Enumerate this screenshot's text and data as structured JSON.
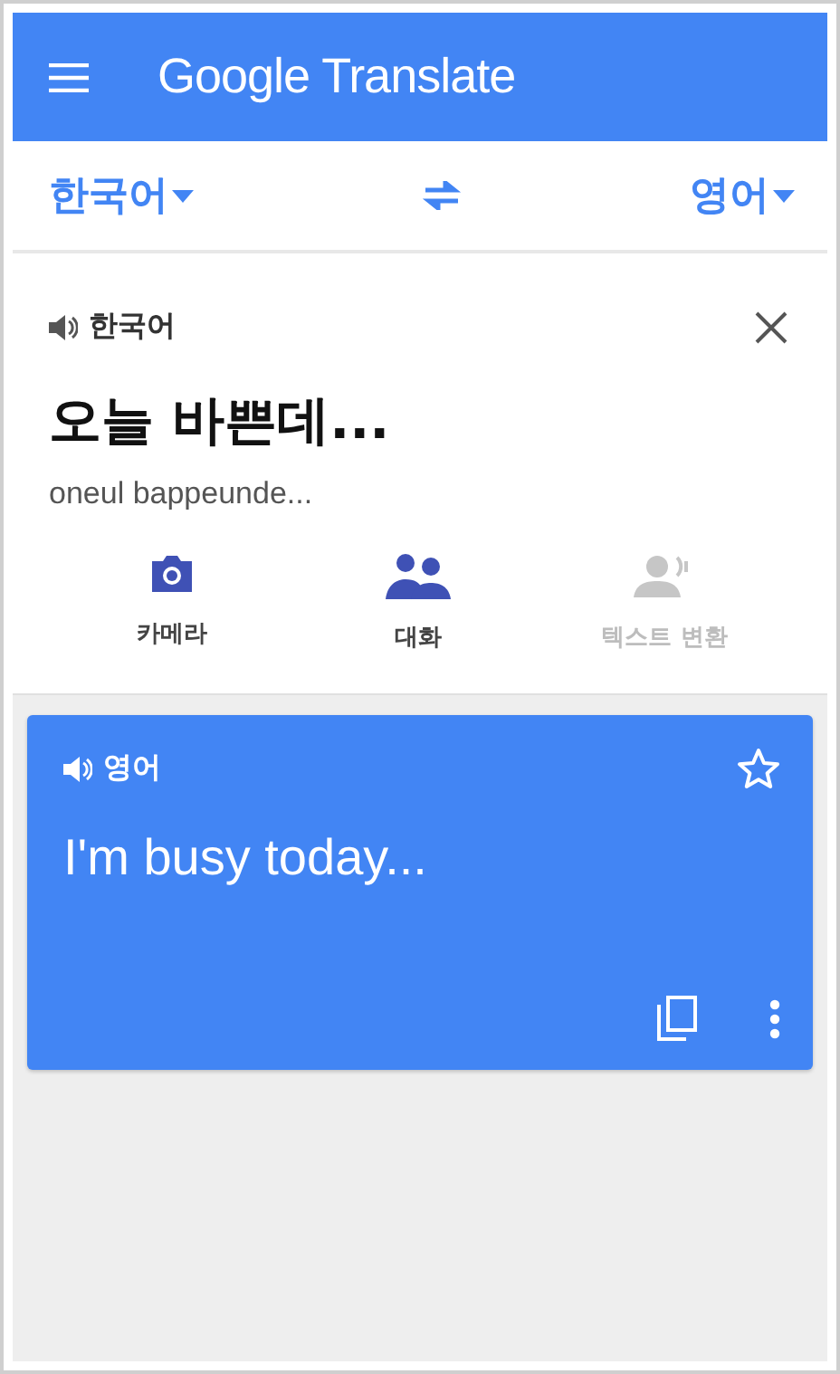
{
  "app_bar": {
    "title": "Google Translate"
  },
  "language_bar": {
    "source": "한국어",
    "target": "영어"
  },
  "input": {
    "language": "한국어",
    "text": "오늘 바쁜데...",
    "romanization": "oneul bappeunde..."
  },
  "tools": [
    {
      "kind": "camera",
      "label": "카메라",
      "disabled": false
    },
    {
      "kind": "conversation",
      "label": "대화",
      "disabled": false
    },
    {
      "kind": "transcribe",
      "label": "텍스트 변환",
      "disabled": true
    }
  ],
  "result": {
    "language": "영어",
    "text": "I'm busy today...",
    "starred": false
  }
}
